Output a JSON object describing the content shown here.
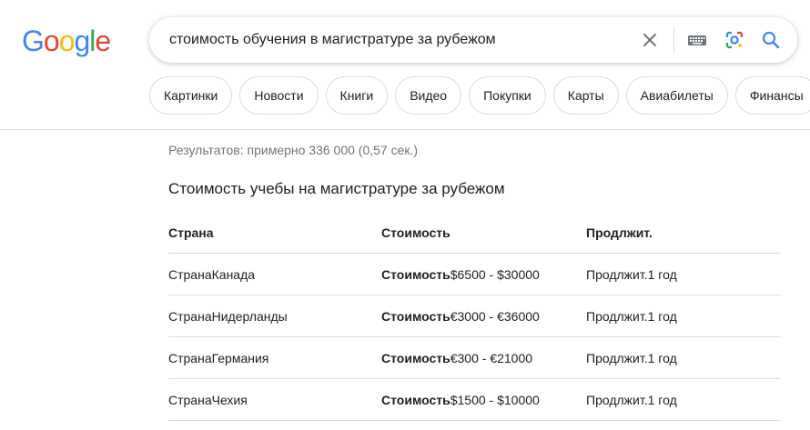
{
  "logo": {
    "letters": [
      "G",
      "o",
      "o",
      "g",
      "l",
      "e"
    ],
    "colors": [
      "#4285f4",
      "#ea4335",
      "#fbbc05",
      "#4285f4",
      "#34a853",
      "#ea4335"
    ]
  },
  "search": {
    "query": "стоимость обучения в магистратуре за рубежом",
    "icons": [
      "close-icon",
      "keyboard-icon",
      "google-lens-icon",
      "search-icon"
    ]
  },
  "chips": [
    "Картинки",
    "Новости",
    "Книги",
    "Видео",
    "Покупки",
    "Карты",
    "Авиабилеты",
    "Финансы"
  ],
  "stats": "Результатов: примерно 336 000 (0,57 сек.)",
  "snippet": {
    "title": "Стоимость учебы на магистратуре за рубежом",
    "headers": [
      "Страна",
      "Стоимость",
      "Продлжит."
    ],
    "rows": [
      {
        "country_label": "Страна",
        "country": "Канада",
        "cost_label": "Стоимость",
        "cost": "$6500 - $30000",
        "dur_label": "Продлжит.",
        "dur": "1 год"
      },
      {
        "country_label": "Страна",
        "country": "Нидерланды",
        "cost_label": "Стоимость",
        "cost": "€3000 - €36000",
        "dur_label": "Продлжит.",
        "dur": "1 год"
      },
      {
        "country_label": "Страна",
        "country": "Германия",
        "cost_label": "Стоимость",
        "cost": "€300 - €21000",
        "dur_label": "Продлжит.",
        "dur": "1 год"
      },
      {
        "country_label": "Страна",
        "country": "Чехия",
        "cost_label": "Стоимость",
        "cost": "$1500 - $10000",
        "dur_label": "Продлжит.",
        "dur": "1 год"
      }
    ]
  }
}
